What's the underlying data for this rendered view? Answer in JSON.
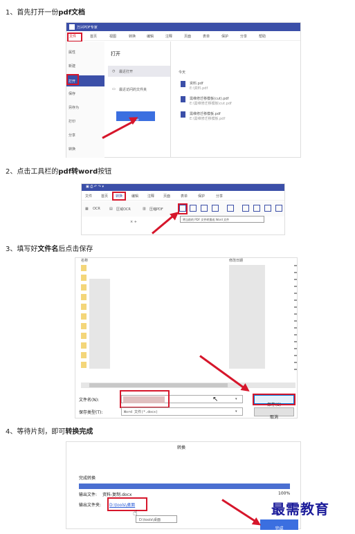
{
  "steps": [
    {
      "num": "1、",
      "pre": "首先打开一份",
      "bold": "pdf文档",
      "post": ""
    },
    {
      "num": "2、",
      "pre": "点击工具栏的",
      "bold": "pdf转word",
      "post": "按钮"
    },
    {
      "num": "3、",
      "pre": "填写好",
      "bold": "文件名",
      "post": "后点击保存"
    },
    {
      "num": "4、",
      "pre": "等待片刻，即可",
      "bold": "转换完成",
      "post": ""
    }
  ],
  "s1": {
    "app_title": "万兴PDF专家",
    "menu": [
      "文件",
      "首页",
      "视图",
      "转换",
      "编辑",
      "注释",
      "页面",
      "表单",
      "保护",
      "分享",
      "帮助"
    ],
    "side": [
      "属性",
      "新建",
      "打开",
      "保存",
      "另存为",
      "打印",
      "分享",
      "转换"
    ],
    "panel_title": "打开",
    "recent_btn": "最近打开",
    "recent_folder": "最近访问的文件夹",
    "browse": "浏览",
    "today": "今天",
    "files": [
      {
        "name": "资料.pdf",
        "path": "E:\\资料.pdf"
      },
      {
        "name": "需维修迁移模板(cut).pdf",
        "path": "E:\\需维修迁移模板\\cut.pdf"
      },
      {
        "name": "需维修迁移模板.pdf",
        "path": "E:\\需维修迁移模板.pdf"
      }
    ]
  },
  "s2": {
    "menu": [
      "文件",
      "首页",
      "视图",
      "转换",
      "编辑",
      "注释",
      "页面",
      "表单",
      "保护",
      "分享"
    ],
    "tools": [
      "OCR",
      "区域OCR",
      "压缩PDF"
    ],
    "tooltip": "将当前的 PDF 文件转换成 Word 文件"
  },
  "s3": {
    "col1": "名称",
    "col2": "修改日期",
    "filename_label": "文件名(N):",
    "filetype_label": "保存类型(T):",
    "filetype_value": "Word 文件(*.docx)",
    "save": "保存(S)",
    "cancel": "取消"
  },
  "s4": {
    "title": "转换",
    "status": "完成转换",
    "progress_pct": 100,
    "progress_label": "100%",
    "output_file_label": "输出文件:",
    "output_file": "资料-复制.docx",
    "output_folder_label": "输出文件夹:",
    "output_folder": "D:\\tools\\桌面",
    "tooltip": "D:\\tools\\桌面",
    "done": "完成"
  },
  "watermark": "最需教育",
  "colors": {
    "accent": "#3b4fa8",
    "red": "#d6162b",
    "progress": "#4a6fd1"
  }
}
